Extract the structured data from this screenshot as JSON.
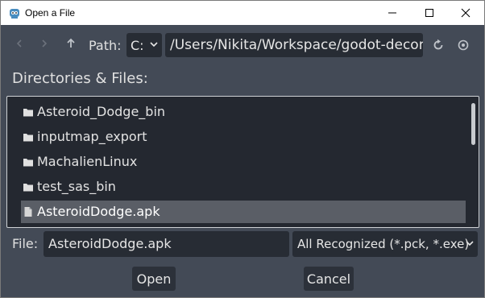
{
  "window": {
    "title": "Open a File"
  },
  "toolbar": {
    "path_label": "Path:",
    "drive": "C:",
    "path": "/Users/Nikita/Workspace/godot-decom"
  },
  "browser": {
    "heading": "Directories & Files:",
    "items": [
      {
        "label": "Asteroid_Dodge_bin",
        "icon": "folder-icon"
      },
      {
        "label": "inputmap_export",
        "icon": "folder-icon"
      },
      {
        "label": "MachalienLinux",
        "icon": "folder-icon"
      },
      {
        "label": "test_sas_bin",
        "icon": "folder-icon"
      },
      {
        "label": "AsteroidDodge.apk",
        "icon": "file-icon",
        "selected": true
      }
    ]
  },
  "file": {
    "label": "File:",
    "name": "AsteroidDodge.apk",
    "filter": "All Recognized (*.pck, *.exe)"
  },
  "buttons": {
    "open": "Open",
    "cancel": "Cancel"
  },
  "colors": {
    "background": "#434a56",
    "field": "#272c34",
    "selection": "#5a5e66"
  }
}
